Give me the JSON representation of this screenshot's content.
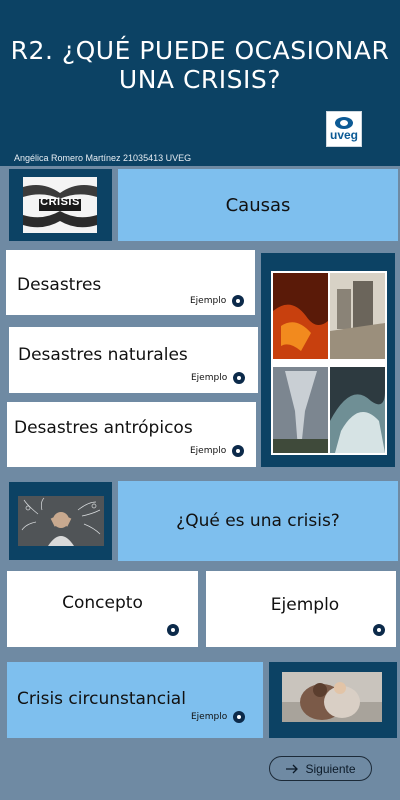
{
  "header": {
    "title_line1": "R2. ¿QUÉ PUEDE OCASIONAR",
    "title_line2": "UNA CRISIS?",
    "author": "Angélica Romero Martínez 21035413 UVEG",
    "logo_text": "uveg"
  },
  "causes": {
    "image_text": "CRISIS",
    "label": "Causas"
  },
  "disasters": [
    {
      "label": "Desastres",
      "example": "Ejemplo"
    },
    {
      "label": "Desastres naturales",
      "example": "Ejemplo"
    },
    {
      "label": "Desastres antrópicos",
      "example": "Ejemplo"
    }
  ],
  "whatis": {
    "label": "¿Qué es una crisis?"
  },
  "concept": {
    "label": "Concepto"
  },
  "example_card": {
    "label": "Ejemplo"
  },
  "circumstantial": {
    "label": "Crisis circunstancial",
    "example": "Ejemplo"
  },
  "next_button": {
    "label": "Siguiente",
    "icon": "arrow-right-icon"
  },
  "colors": {
    "background": "#6f8aa3",
    "dark_blue": "#0c4264",
    "light_blue": "#7ebfee",
    "card": "#ffffff"
  }
}
